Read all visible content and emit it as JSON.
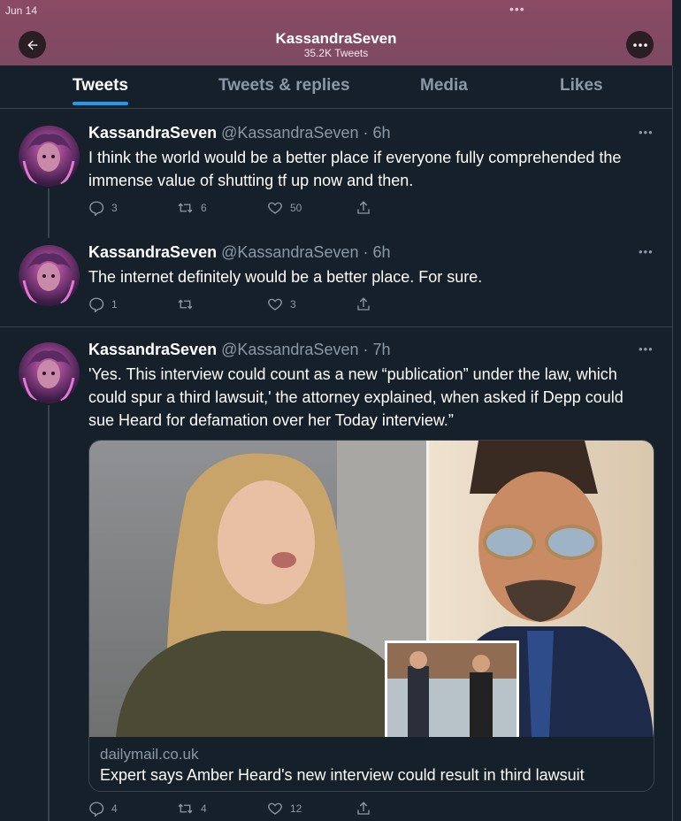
{
  "status": {
    "date": "Jun 14"
  },
  "profile": {
    "name": "KassandraSeven",
    "tweet_count": "35.2K Tweets"
  },
  "tabs": [
    {
      "label": "Tweets",
      "active": true
    },
    {
      "label": "Tweets & replies",
      "active": false
    },
    {
      "label": "Media",
      "active": false
    },
    {
      "label": "Likes",
      "active": false
    }
  ],
  "tweets": [
    {
      "name": "KassandraSeven",
      "handle_time": "@KassandraSeven · 6h",
      "text": "I think the world would be a better place if everyone fully comprehended the immense value of shutting tf up now and then.",
      "replies": "3",
      "retweets": "6",
      "likes": "50"
    },
    {
      "name": "KassandraSeven",
      "handle_time": "@KassandraSeven · 6h",
      "text": "The internet definitely would be a better place. For sure.",
      "replies": "1",
      "retweets": "",
      "likes": "3"
    },
    {
      "name": "KassandraSeven",
      "handle_time": "@KassandraSeven · 7h",
      "text": "'Yes. This interview could count as a new “publication” under the law, which could spur a third lawsuit,' the attorney explained, when asked if Depp could sue Heard for defamation over her Today interview.”",
      "replies": "4",
      "retweets": "4",
      "likes": "12",
      "card": {
        "domain": "dailymail.co.uk",
        "title": "Expert says Amber Heard's new interview could result in third lawsuit"
      }
    }
  ],
  "colors": {
    "header_bg": "#8a4a64",
    "background": "#15202b",
    "accent": "#1d9bf0",
    "muted_text": "#8b98a5",
    "border": "#38444d"
  },
  "icons": [
    "back-arrow-icon",
    "more-icon",
    "reply-icon",
    "retweet-icon",
    "like-icon",
    "share-icon"
  ]
}
